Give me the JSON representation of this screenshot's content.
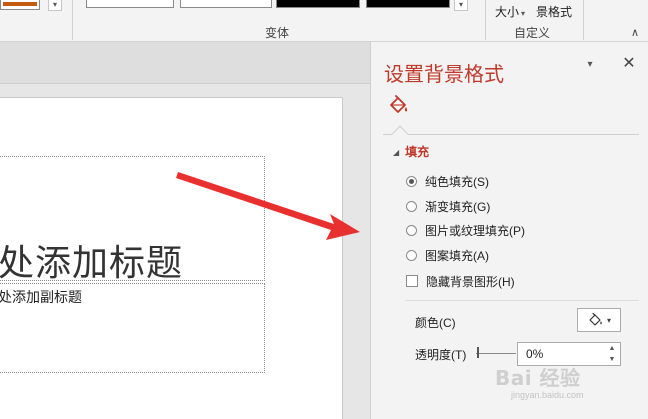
{
  "ribbon": {
    "variants_group_label": "变体",
    "size_button_label": "大小",
    "size_dropdown_glyph": "▾",
    "background_format_label": "景格式",
    "customize_group_label": "自定义",
    "gallery_dropdown_glyph": "▾",
    "collapse_glyph": "∧"
  },
  "slide": {
    "title_text": "处添加标题",
    "subtitle_text": "处添加副标题"
  },
  "pane": {
    "title": "设置背景格式",
    "menu_glyph": "▾",
    "close_glyph": "✕",
    "section_title": "填充",
    "section_triangle": "◢",
    "fill_options": [
      {
        "label": "纯色填充(S)",
        "selected": true
      },
      {
        "label": "渐变填充(G)",
        "selected": false
      },
      {
        "label": "图片或纹理填充(P)",
        "selected": false
      },
      {
        "label": "图案填充(A)",
        "selected": false
      }
    ],
    "hide_background_label": "隐藏背景图形(H)",
    "color_label": "颜色(C)",
    "color_caret": "▾",
    "transparency_label": "透明度(T)",
    "transparency_value": "0%",
    "spin_up": "▲",
    "spin_down": "▼"
  },
  "watermark": {
    "text": "Bai 经验",
    "url": "jingyan.baidu.com"
  },
  "colors": {
    "accent_red": "#c0392b",
    "arrow_red": "#e8302f"
  }
}
